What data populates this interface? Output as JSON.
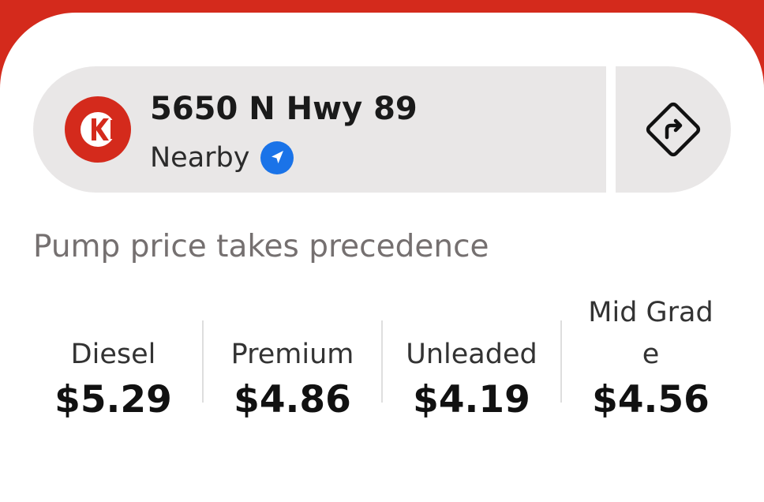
{
  "store": {
    "address": "5650 N Hwy 89",
    "proximity_label": "Nearby",
    "brand_color": "#d42a1c",
    "icons": {
      "brand": "circle-k-logo",
      "location": "location-arrow-icon",
      "directions": "directions-turn-icon"
    }
  },
  "notice": "Pump price takes precedence",
  "fuels": [
    {
      "name": "Diesel",
      "price": "$5.29"
    },
    {
      "name": "Premium",
      "price": "$4.86"
    },
    {
      "name": "Unleaded",
      "price": "$4.19"
    },
    {
      "name": "Mid Grade",
      "price": "$4.56"
    }
  ]
}
